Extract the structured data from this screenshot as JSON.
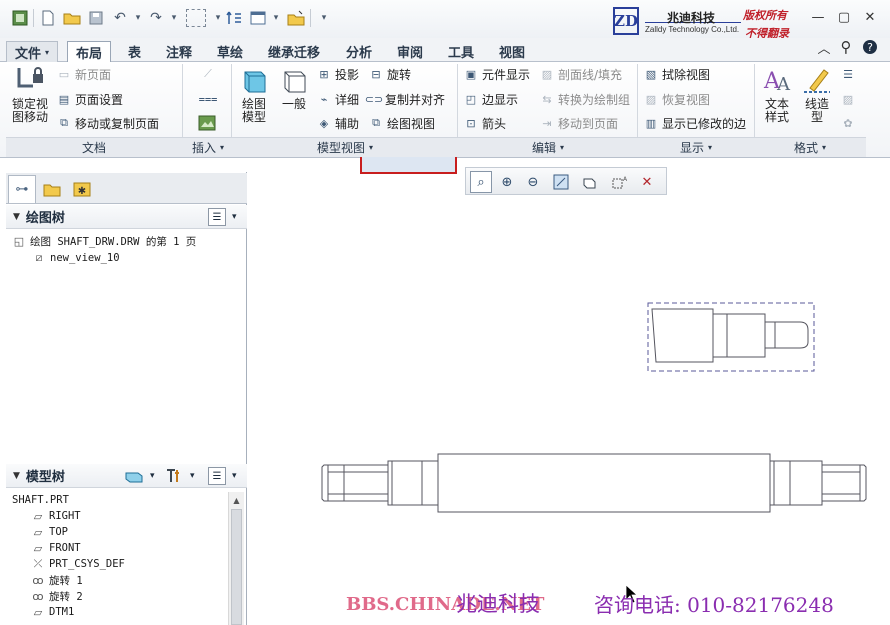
{
  "quick_access": {
    "icons": [
      "app-icon",
      "new-icon",
      "open-icon",
      "save-icon",
      "undo-icon",
      "redo-icon",
      "select-box-icon",
      "regenerate-icon",
      "windows-icon",
      "folder-icon",
      "more-icon"
    ]
  },
  "logo": {
    "mark": "ZD",
    "name_cn": "兆迪科技",
    "name_en": "Zalldy Technology Co.,Ltd.",
    "stamp_line1": "版权所有",
    "stamp_line2": "不得翻录"
  },
  "menu": {
    "file": "文件",
    "tabs": [
      "布局",
      "表",
      "注释",
      "草绘",
      "继承迁移",
      "分析",
      "审阅",
      "工具",
      "视图"
    ],
    "active": "布局"
  },
  "ribbon": {
    "groups": {
      "document": "文档",
      "insert": "插入",
      "model_views": "模型视图",
      "edit": "编辑",
      "display": "显示",
      "format": "格式"
    },
    "document": {
      "lock_view": "锁定视图移动",
      "new_page": "新页面",
      "page_setup": "页面设置",
      "move_copy_page": "移动或复制页面"
    },
    "model_views": {
      "drawing_model": "绘图模型",
      "general": "一般",
      "projection": "投影",
      "detailed": "详细",
      "auxiliary": "辅助",
      "rotate": "旋转",
      "copy_align": "复制并对齐",
      "drawing_view": "绘图视图"
    },
    "edit": {
      "element_display": "元件显示",
      "edge_display": "边显示",
      "arrow": "箭头",
      "section_line_fill": "剖面线/填充",
      "convert_to_group": "转换为绘制组",
      "move_to_page": "移动到页面"
    },
    "display": {
      "erase_view": "拭除视图",
      "restore_view": "恢复视图",
      "show_modified_edges": "显示已修改的边"
    },
    "format": {
      "text_style": "文本样式",
      "line_style": "线造型"
    }
  },
  "left_panel": {
    "drawing_tree_title": "绘图树",
    "drawing_tree": [
      {
        "label": "绘图 SHAFT_DRW.DRW 的第 1 页",
        "icon": "drawing-sheet-icon"
      },
      {
        "label": "new_view_10",
        "icon": "view-icon"
      }
    ],
    "model_tree_title": "模型树",
    "model_tree": [
      {
        "label": "SHAFT.PRT",
        "icon": ""
      },
      {
        "label": "RIGHT",
        "icon": "datum-plane-icon"
      },
      {
        "label": "TOP",
        "icon": "datum-plane-icon"
      },
      {
        "label": "FRONT",
        "icon": "datum-plane-icon"
      },
      {
        "label": "PRT_CSYS_DEF",
        "icon": "csys-icon"
      },
      {
        "label": "旋转 1",
        "icon": "revolve-icon"
      },
      {
        "label": "旋转 2",
        "icon": "revolve-icon"
      },
      {
        "label": "DTM1",
        "icon": "datum-plane-icon"
      }
    ]
  },
  "footer": {
    "bbs": "BBS.CHINADE.NET",
    "company": "兆迪科技",
    "phone": "咨询电话: 010-82176248"
  }
}
